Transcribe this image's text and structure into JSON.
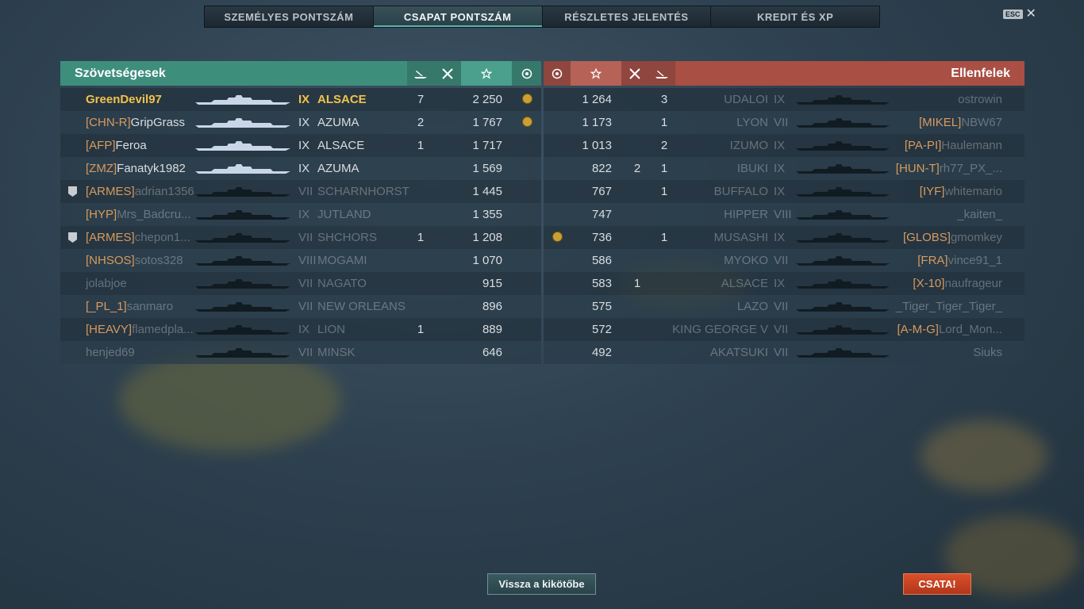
{
  "tabs": [
    {
      "label": "SZEMÉLYES PONTSZÁM",
      "active": false
    },
    {
      "label": "CSAPAT PONTSZÁM",
      "active": true
    },
    {
      "label": "RÉSZLETES JELENTÉS",
      "active": false
    },
    {
      "label": "KREDIT ÉS XP",
      "active": false
    }
  ],
  "esc_label": "ESC",
  "close_symbol": "✕",
  "ally": {
    "title": "Szövetségesek",
    "header_icons": [
      "ship-sunk-icon",
      "plane-kill-icon",
      "star-icon",
      "medal-icon"
    ],
    "players": [
      {
        "clan": "",
        "name": "GreenDevil97",
        "tier": "IX",
        "ship": "ALSACE",
        "kills": "7",
        "score": "2 250",
        "medal": true,
        "you": true,
        "alive": true
      },
      {
        "clan": "[CHN-R]",
        "name": "GripGrass",
        "tier": "IX",
        "ship": "AZUMA",
        "kills": "2",
        "score": "1 767",
        "medal": true,
        "alive": true
      },
      {
        "clan": "[AFP]",
        "name": "Feroa",
        "tier": "IX",
        "ship": "ALSACE",
        "kills": "1",
        "score": "1 717",
        "medal": false,
        "alive": true
      },
      {
        "clan": "[ZMZ]",
        "name": "Fanatyk1982",
        "tier": "IX",
        "ship": "AZUMA",
        "kills": "",
        "score": "1 569",
        "medal": false,
        "alive": true
      },
      {
        "clan": "[ARMES]",
        "name": "adrian1356",
        "tier": "VII",
        "ship": "SCHARNHORST",
        "kills": "",
        "score": "1 445",
        "medal": false,
        "badge": true,
        "alive": false
      },
      {
        "clan": "[HYP]",
        "name": "Mrs_Badcru...",
        "tier": "IX",
        "ship": "JUTLAND",
        "kills": "",
        "score": "1 355",
        "medal": false,
        "alive": false
      },
      {
        "clan": "[ARMES]",
        "name": "chepon1...",
        "tier": "VII",
        "ship": "SHCHORS",
        "kills": "1",
        "score": "1 208",
        "medal": false,
        "badge": true,
        "alive": false
      },
      {
        "clan": "[NHSOS]",
        "name": "sotos328",
        "tier": "VIII",
        "ship": "MOGAMI",
        "kills": "",
        "score": "1 070",
        "medal": false,
        "alive": false
      },
      {
        "clan": "",
        "name": "jolabjoe",
        "tier": "VII",
        "ship": "NAGATO",
        "kills": "",
        "score": "915",
        "medal": false,
        "alive": false
      },
      {
        "clan": "[_PL_1]",
        "name": "sanmaro",
        "tier": "VII",
        "ship": "NEW ORLEANS",
        "kills": "",
        "score": "896",
        "medal": false,
        "alive": false
      },
      {
        "clan": "[HEAVY]",
        "name": "flamedpla...",
        "tier": "IX",
        "ship": "LION",
        "kills": "1",
        "score": "889",
        "medal": false,
        "alive": false
      },
      {
        "clan": "",
        "name": "henjed69",
        "tier": "VII",
        "ship": "MINSK",
        "kills": "",
        "score": "646",
        "medal": false,
        "alive": false
      }
    ]
  },
  "enemy": {
    "title": "Ellenfelek",
    "header_icons": [
      "medal-icon",
      "star-icon",
      "plane-kill-icon",
      "ship-sunk-icon"
    ],
    "players": [
      {
        "clan": "",
        "name": "ostrowin",
        "tier": "IX",
        "ship": "UDALOI",
        "planes": "",
        "kills": "3",
        "score": "1 264",
        "medal": false
      },
      {
        "clan": "[MIKEL]",
        "name": "NBW67",
        "tier": "VII",
        "ship": "LYON",
        "planes": "",
        "kills": "1",
        "score": "1 173",
        "medal": false
      },
      {
        "clan": "[PA-PI]",
        "name": "Haulemann",
        "tier": "IX",
        "ship": "IZUMO",
        "planes": "",
        "kills": "2",
        "score": "1 013",
        "medal": false
      },
      {
        "clan": "[HUN-T]",
        "name": "rh77_PX_...",
        "tier": "IX",
        "ship": "IBUKI",
        "planes": "2",
        "kills": "1",
        "score": "822",
        "medal": false
      },
      {
        "clan": "[IYF]",
        "name": "whitemario",
        "tier": "IX",
        "ship": "BUFFALO",
        "planes": "",
        "kills": "1",
        "score": "767",
        "medal": false
      },
      {
        "clan": "",
        "name": "_kaiten_",
        "tier": "VIII",
        "ship": "HIPPER",
        "planes": "",
        "kills": "",
        "score": "747",
        "medal": false
      },
      {
        "clan": "[GLOBS]",
        "name": "gmomkey",
        "tier": "IX",
        "ship": "MUSASHI",
        "planes": "",
        "kills": "1",
        "score": "736",
        "medal": true
      },
      {
        "clan": "[FRA]",
        "name": "vince91_1",
        "tier": "VII",
        "ship": "MYOKO",
        "planes": "",
        "kills": "",
        "score": "586",
        "medal": false
      },
      {
        "clan": "[X-10]",
        "name": "naufrageur",
        "tier": "IX",
        "ship": "ALSACE",
        "planes": "1",
        "kills": "",
        "score": "583",
        "medal": false
      },
      {
        "clan": "",
        "name": "_Tiger_Tiger_Tiger_",
        "tier": "VII",
        "ship": "LAZO",
        "planes": "",
        "kills": "",
        "score": "575",
        "medal": false
      },
      {
        "clan": "[A-M-G]",
        "name": "Lord_Mon...",
        "tier": "VII",
        "ship": "KING GEORGE V",
        "planes": "",
        "kills": "",
        "score": "572",
        "medal": false
      },
      {
        "clan": "",
        "name": "Siuks",
        "tier": "VII",
        "ship": "AKATSUKI",
        "planes": "",
        "kills": "",
        "score": "492",
        "medal": false
      }
    ]
  },
  "buttons": {
    "back": "Vissza a kikötőbe",
    "battle": "CSATA!"
  }
}
